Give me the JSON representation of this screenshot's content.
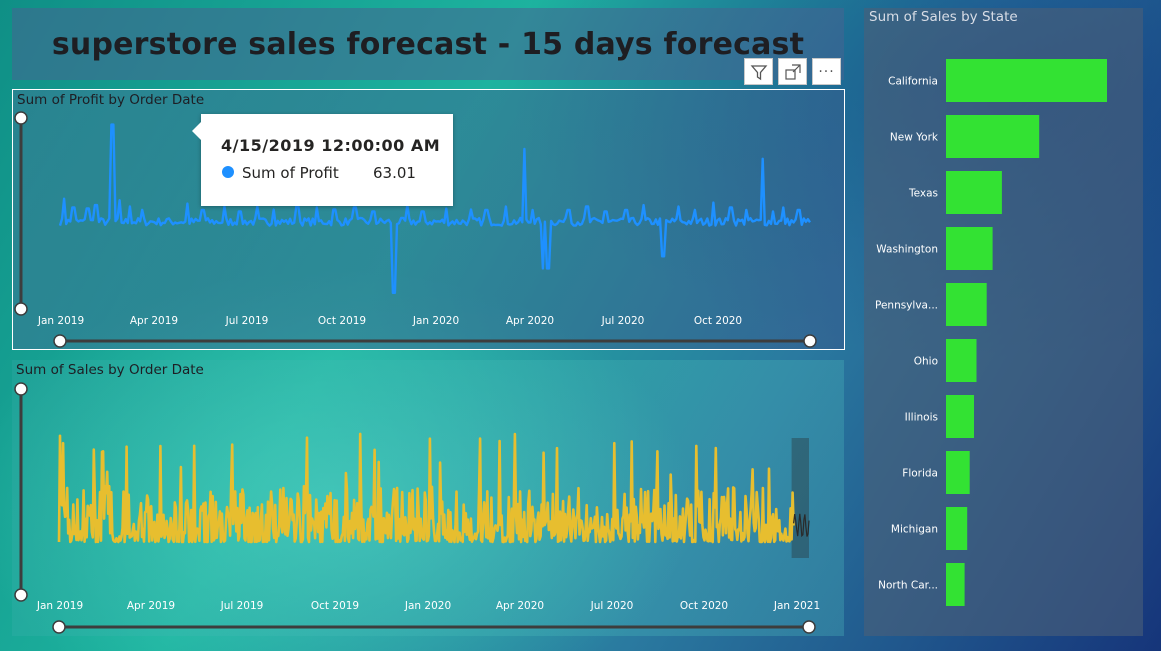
{
  "dashboard": {
    "title": "superstore sales forecast - 15 days forecast"
  },
  "visual_toolbar": {
    "filter_icon": "filter-icon",
    "focus_icon": "focus-mode-icon",
    "more_icon": "more-options-icon",
    "more_label": "···"
  },
  "tooltip": {
    "date": "4/15/2019 12:00:00 AM",
    "series": "Sum of Profit",
    "value": "63.01",
    "color": "#1e90ff"
  },
  "chart_data": [
    {
      "id": "profit",
      "type": "line",
      "title": "Sum of Profit by Order Date",
      "color": "#1e90ff",
      "tick_labels": [
        "Jan 2019",
        "Apr 2019",
        "Jul 2019",
        "Oct 2019",
        "Jan 2020",
        "Apr 2020",
        "Jul 2020",
        "Oct 2020"
      ],
      "x_range": [
        "2019-01-01",
        "2020-12-31"
      ],
      "ylim": [
        -1700,
        2300
      ],
      "series": [
        {
          "name": "Sum of Profit",
          "baseline": 0,
          "spikes": [
            {
              "x": "2019-01-05",
              "y": 480
            },
            {
              "x": "2019-01-14",
              "y": 300
            },
            {
              "x": "2019-01-28",
              "y": 280
            },
            {
              "x": "2019-02-05",
              "y": 350
            },
            {
              "x": "2019-02-21",
              "y": 2000
            },
            {
              "x": "2019-02-28",
              "y": 450
            },
            {
              "x": "2019-03-10",
              "y": 320
            },
            {
              "x": "2019-03-22",
              "y": 250
            },
            {
              "x": "2019-04-15",
              "y": 63.01
            },
            {
              "x": "2019-05-05",
              "y": 380
            },
            {
              "x": "2019-05-20",
              "y": 250
            },
            {
              "x": "2019-06-10",
              "y": 320
            },
            {
              "x": "2019-06-25",
              "y": 220
            },
            {
              "x": "2019-07-12",
              "y": 320
            },
            {
              "x": "2019-07-28",
              "y": 260
            },
            {
              "x": "2019-08-20",
              "y": 320
            },
            {
              "x": "2019-09-08",
              "y": 300
            },
            {
              "x": "2019-09-25",
              "y": 260
            },
            {
              "x": "2019-10-15",
              "y": 300
            },
            {
              "x": "2019-11-02",
              "y": 220
            },
            {
              "x": "2019-11-22",
              "y": -1450
            },
            {
              "x": "2019-12-05",
              "y": 350
            },
            {
              "x": "2019-12-20",
              "y": 220
            },
            {
              "x": "2020-01-12",
              "y": 280
            },
            {
              "x": "2020-02-05",
              "y": 260
            },
            {
              "x": "2020-02-20",
              "y": 250
            },
            {
              "x": "2020-03-10",
              "y": 320
            },
            {
              "x": "2020-03-28",
              "y": 1500
            },
            {
              "x": "2020-04-05",
              "y": 250
            },
            {
              "x": "2020-04-15",
              "y": -950
            },
            {
              "x": "2020-04-20",
              "y": -950
            },
            {
              "x": "2020-05-10",
              "y": 250
            },
            {
              "x": "2020-05-28",
              "y": 320
            },
            {
              "x": "2020-06-15",
              "y": 220
            },
            {
              "x": "2020-07-05",
              "y": 250
            },
            {
              "x": "2020-07-22",
              "y": 350
            },
            {
              "x": "2020-08-10",
              "y": -700
            },
            {
              "x": "2020-08-25",
              "y": 320
            },
            {
              "x": "2020-09-10",
              "y": 250
            },
            {
              "x": "2020-09-28",
              "y": 400
            },
            {
              "x": "2020-10-15",
              "y": 300
            },
            {
              "x": "2020-10-30",
              "y": 250
            },
            {
              "x": "2020-11-15",
              "y": 1300
            },
            {
              "x": "2020-11-25",
              "y": 220
            },
            {
              "x": "2020-12-05",
              "y": 300
            },
            {
              "x": "2020-12-20",
              "y": 250
            }
          ]
        }
      ]
    },
    {
      "id": "sales",
      "type": "line",
      "title": "Sum of Sales by Order Date",
      "color": "#e7be2f",
      "forecast_color": "#2a2a2a",
      "tick_labels": [
        "Jan 2019",
        "Apr 2019",
        "Jul 2019",
        "Oct 2019",
        "Jan 2020",
        "Apr 2020",
        "Jul 2020",
        "Oct 2020",
        "Jan 2021"
      ],
      "x_range": [
        "2019-01-01",
        "2021-01-02"
      ],
      "ylim": [
        0,
        30000
      ],
      "forecast_days": 15
    },
    {
      "id": "state",
      "type": "bar",
      "orientation": "horizontal",
      "title": "Sum of Sales by State",
      "color": "#33e233",
      "categories": [
        "California",
        "New York",
        "Texas",
        "Washington",
        "Pennsylva...",
        "Ohio",
        "Illinois",
        "Florida",
        "Michigan",
        "North Car..."
      ],
      "values": [
        95000,
        55000,
        33000,
        27500,
        24000,
        18000,
        16500,
        14000,
        12500,
        11000
      ]
    }
  ]
}
